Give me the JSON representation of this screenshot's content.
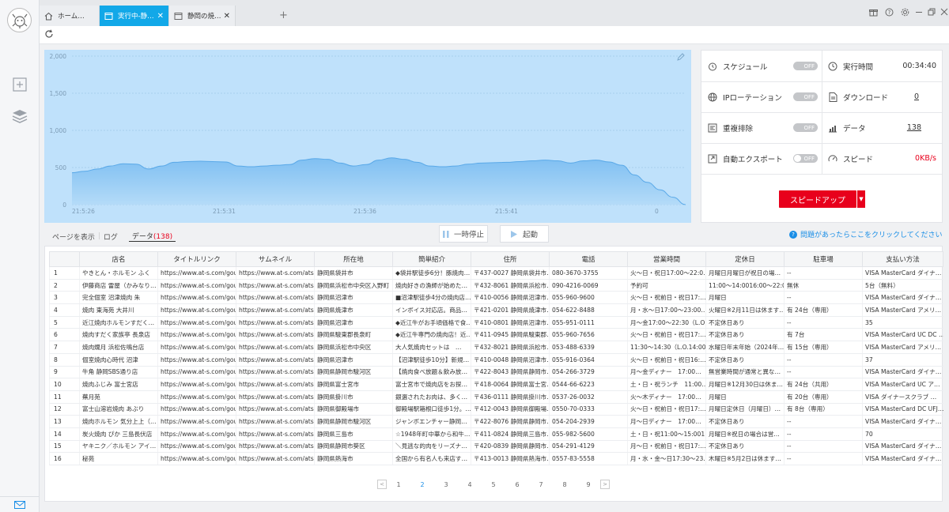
{
  "window": {
    "tabs": [
      {
        "label": "ホーム…",
        "icon": "home-icon"
      },
      {
        "label": "実行中-静…",
        "icon": "tab-page-icon",
        "active": true
      },
      {
        "label": "静岡の焼…",
        "icon": "tab-page-icon"
      }
    ],
    "new_tab": "+",
    "controls": [
      "gift-icon",
      "help-icon",
      "settings-icon",
      "minimize-icon",
      "restore-icon",
      "close-icon"
    ]
  },
  "chart_data": {
    "type": "area",
    "x": [
      "21:5:26",
      "21:5:31",
      "21:5:36",
      "21:5:41"
    ],
    "ylim": [
      0,
      2000
    ],
    "yticks": [
      "2,000",
      "1,500",
      "1,000",
      "500",
      "0"
    ],
    "xend_label": "0",
    "series": [
      {
        "values": [
          430,
          450,
          480,
          520,
          550,
          545,
          480,
          520,
          570,
          580,
          585,
          580,
          575,
          520,
          510,
          520,
          530,
          540,
          600,
          620,
          610,
          560,
          520,
          540,
          600,
          630,
          610,
          570,
          520,
          510,
          520,
          545,
          560,
          565,
          570,
          580,
          590,
          600,
          590,
          560,
          590,
          600,
          575,
          530,
          400,
          300,
          200,
          100,
          0
        ]
      }
    ],
    "color": "#8ec9f5"
  },
  "stats": {
    "schedule": {
      "label": "スケジュール",
      "toggle": "OFF"
    },
    "runtime": {
      "label": "実行時間",
      "value": "00:34:40"
    },
    "ip": {
      "label": "IPローテーション",
      "toggle": "OFF"
    },
    "download": {
      "label": "ダウンロード",
      "value": "0"
    },
    "dedupe": {
      "label": "重複排除",
      "toggle": "OFF"
    },
    "data": {
      "label": "データ",
      "value": "138"
    },
    "autoexport": {
      "label": "自動エクスポート",
      "toggle": "OFF"
    },
    "speed": {
      "label": "スピード",
      "value": "0KB/s"
    },
    "speedup": "スピードアップ"
  },
  "view_tabs": {
    "page": "ページを表示",
    "log": "ログ",
    "data": "データ(138)"
  },
  "controls": {
    "pause": "一時停止",
    "start": "起動"
  },
  "help_link": "問題があったらここをクリックしてください",
  "table": {
    "headers": [
      "",
      "店名",
      "タイトルリンク",
      "サムネイル",
      "所在地",
      "簡単紹介",
      "住所",
      "電話",
      "営業時間",
      "定休日",
      "駐車場",
      "支払い方法"
    ],
    "rows": [
      [
        "1",
        "やきとん・ホルモン ふく",
        "https://www.at-s.com/gour…",
        "https://www.at-s.com/ats-t…",
        "静岡県袋井市",
        "◆袋井駅徒歩6分！豚焼肉…",
        "〒437-0027 静岡県袋井市…",
        "080-3670-3755",
        "火～日・祝日17:00～22:0…",
        "月曜日月曜日が祝日の場…",
        "--",
        "VISA MasterCard ダイナ…"
      ],
      [
        "2",
        "伊藤商店 雷屋（かみなり…",
        "https://www.at-s.com/gour…",
        "https://www.at-s.com/ats-t…",
        "静岡県浜松市中央区入野町",
        "焼肉好きの漁師が始めた…",
        "〒432-8061 静岡県浜松市…",
        "090-4216-0069",
        "予約可",
        "11:00～14:0016:00～22:00",
        "無休",
        "5台（無料）"
      ],
      [
        "3",
        "完全個室 沼津焼肉 朱",
        "https://www.at-s.com/gour…",
        "https://www.at-s.com/ats-t…",
        "静岡県沼津市",
        "■沼津駅徒歩4分の焼肉店…",
        "〒410-0056 静岡県沼津市…",
        "055-960-9600",
        "火～日・祝前日・祝日17:…",
        "月曜日",
        "--",
        "VISA MasterCard ダイナ…"
      ],
      [
        "4",
        "焼肉 東海苑 大井川",
        "https://www.at-s.com/gour…",
        "https://www.at-s.com/ats-t…",
        "静岡県焼津市",
        "インボイス対応店。商品…",
        "〒421-0201 静岡県焼津市…",
        "054-622-8488",
        "月・水～日17:00～23:00…",
        "火曜日※2月11日は休ます…",
        "有 24台（専用）",
        "VISA MasterCard アメリ…"
      ],
      [
        "5",
        "近江焼肉ホルモンすだく…",
        "https://www.at-s.com/gour…",
        "https://www.at-s.com/ats-t…",
        "静岡県沼津市",
        "◆近江牛がお手頃価格で食…",
        "〒410-0801 静岡県沼津市…",
        "055-951-0111",
        "月～金17:00～22:30（L.O…",
        "不定休日あり",
        "--",
        "35"
      ],
      [
        "6",
        "焼肉すだく家族亭 長泉店",
        "https://www.at-s.com/gour…",
        "https://www.at-s.com/ats-t…",
        "静岡県駿東郡長泉町",
        "◆近江牛専門の焼肉店！近…",
        "〒411-0945 静岡県駿東郡…",
        "055-960-7656",
        "火～日・祝前日・祝日17:…",
        "不定休日あり",
        "有 7台",
        "VISA MasterCard UC DC …"
      ],
      [
        "7",
        "焼肉燗月 浜松佐鳴台店",
        "https://www.at-s.com/gour…",
        "https://www.at-s.com/ats-t…",
        "静岡県浜松市中央区",
        "大人気焼肉セットは　…",
        "〒432-8021 静岡県浜松市…",
        "053-488-6339",
        "11:30～14:30（L.O.14:00…",
        "水曜日年末年始（2024年…",
        "有 15台（専用）",
        "VISA MasterCard アメリ…"
      ],
      [
        "8",
        "個室焼肉心時代 沼津",
        "https://www.at-s.com/gour…",
        "https://www.at-s.com/ats-t…",
        "静岡県沼津市",
        "【沼津駅徒歩10分】新規…",
        "〒410-0048 静岡県沼津市…",
        "055-916-0364",
        "火～日・祝前日・祝日16:…",
        "不定休日あり",
        "--",
        "37"
      ],
      [
        "9",
        "牛角 静岡SBS通り店",
        "https://www.at-s.com/gour…",
        "https://www.at-s.com/ats-t…",
        "静岡県静岡市駿河区",
        "【焼肉食べ放題＆飲み放…",
        "〒422-8043 静岡県静岡市…",
        "054-266-3729",
        "月～金ディナー　17:00…",
        "無営業時間が通常と異な…",
        "--",
        "VISA MasterCard ダイナ…"
      ],
      [
        "10",
        "焼肉ふじみ 富士宮店",
        "https://www.at-s.com/gour…",
        "https://www.at-s.com/ats-t…",
        "静岡県富士宮市",
        "富士宮市で焼肉店をお探…",
        "〒418-0064 静岡県富士宮…",
        "0544-66-6223",
        "土・日・祝ランチ　11:00…",
        "月曜日※12月30日は休ま…",
        "有 24台（共用）",
        "VISA MasterCard UC ア…"
      ],
      [
        "11",
        "蕪月苑",
        "https://www.at-s.com/gour…",
        "https://www.at-s.com/ats-t…",
        "静岡県掛川市",
        "銀選されたお肉は、多く…",
        "〒436-0111 静岡県掛川市…",
        "0537-26-0032",
        "火～木ディナー　17:00…",
        "月曜日",
        "有 20台（専用）",
        "VISA ダイナースクラブ …"
      ],
      [
        "12",
        "富士山溶岩焼肉 あぶり",
        "https://www.at-s.com/gour…",
        "https://www.at-s.com/ats-t…",
        "静岡県御殿場市",
        "御殿場駅箱根口徒歩1分。…",
        "〒412-0043 静岡県御殿場…",
        "0550-70-0333",
        "火～日・祝前日・祝日17:…",
        "月曜日定休日（月曜日）…",
        "有 8台（専用）",
        "VISA MasterCard DC UFJ…"
      ],
      [
        "13",
        "焼肉ホルモン 気分上上（…",
        "https://www.at-s.com/gour…",
        "https://www.at-s.com/ats-t…",
        "静岡県静岡市駿河区",
        "ジャンボエンチャー静岡…",
        "〒422-8076 静岡県静岡市…",
        "054-204-2939",
        "月～日ディナー　17:00…",
        "不定休日あり",
        "--",
        "VISA MasterCard ダイナ…"
      ],
      [
        "14",
        "炭火焼肉 ぴか 三島長伏店",
        "https://www.at-s.com/gour…",
        "https://www.at-s.com/ats-t…",
        "静岡県三島市",
        "☆1948年町中華から和牛…",
        "〒411-0824 静岡県三島市…",
        "055-982-5600",
        "土・日・祝11:00～15:001…",
        "月曜日※祝日の場合は営…",
        "--",
        "70"
      ],
      [
        "15",
        "ヤキニク／ホルモン アイ…",
        "https://www.at-s.com/gour…",
        "https://www.at-s.com/ats-t…",
        "静岡県静岡市葵区",
        "＼見逃な的肉をリーズナ…",
        "〒420-0839 静岡県静岡市…",
        "054-291-4129",
        "月～日・祝前日・祝日17:…",
        "不定休日あり",
        "--",
        "VISA MasterCard ダイナ…"
      ],
      [
        "16",
        "秘苑",
        "https://www.at-s.com/gour…",
        "https://www.at-s.com/ats-t…",
        "静岡県熱海市",
        "全国から有名人も来店す…",
        "〒413-0013 静岡県熱海市…",
        "0557-83-5558",
        "月・水・金～日17:30～23…",
        "木曜日※5月2日は休ます…",
        "--",
        "VISA MasterCard ダイナ…"
      ]
    ]
  },
  "pager": {
    "pages": [
      "1",
      "2",
      "3",
      "4",
      "5",
      "6",
      "7",
      "8",
      "9"
    ],
    "current": "2"
  }
}
